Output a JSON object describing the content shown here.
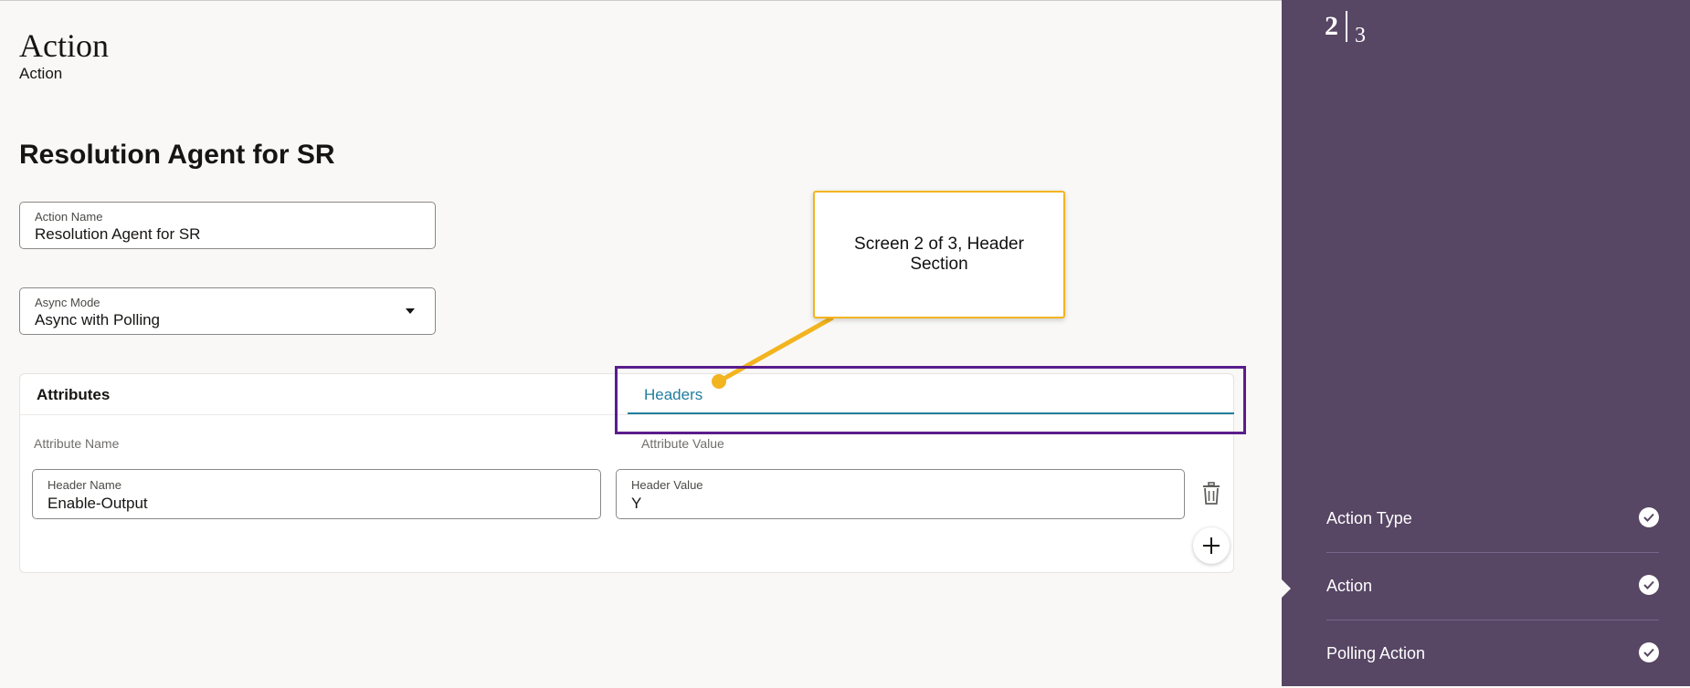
{
  "header": {
    "title": "Action",
    "subtitle": "Action"
  },
  "form": {
    "title": "Resolution Agent for SR",
    "action_name": {
      "label": "Action Name",
      "value": "Resolution Agent for SR"
    },
    "async_mode": {
      "label": "Async Mode",
      "value": "Async with Polling"
    }
  },
  "tabs": [
    {
      "label": "Attributes"
    },
    {
      "label": "Headers",
      "selected": true
    }
  ],
  "table": {
    "columns": [
      "Attribute Name",
      "Attribute Value"
    ],
    "rows": [
      {
        "name_label": "Header Name",
        "name_value": "Enable-Output",
        "value_label": "Header Value",
        "value_value": "Y"
      }
    ]
  },
  "callout": {
    "text": "Screen 2 of 3, Header Section"
  },
  "steps": {
    "current": "2",
    "total": "3",
    "items": [
      {
        "label": "Action Type",
        "done": true
      },
      {
        "label": "Action",
        "done": true,
        "current": true
      },
      {
        "label": "Polling Action",
        "done": true
      }
    ]
  },
  "icons": {
    "delete": "trash-icon",
    "add": "plus-icon",
    "done": "check-circle-icon",
    "dropdown": "caret-down-icon"
  },
  "colors": {
    "accent": "#227e9e",
    "sidebar": "#574664",
    "highlight": "#5b1d8c",
    "callout_border": "#f2b41f"
  }
}
